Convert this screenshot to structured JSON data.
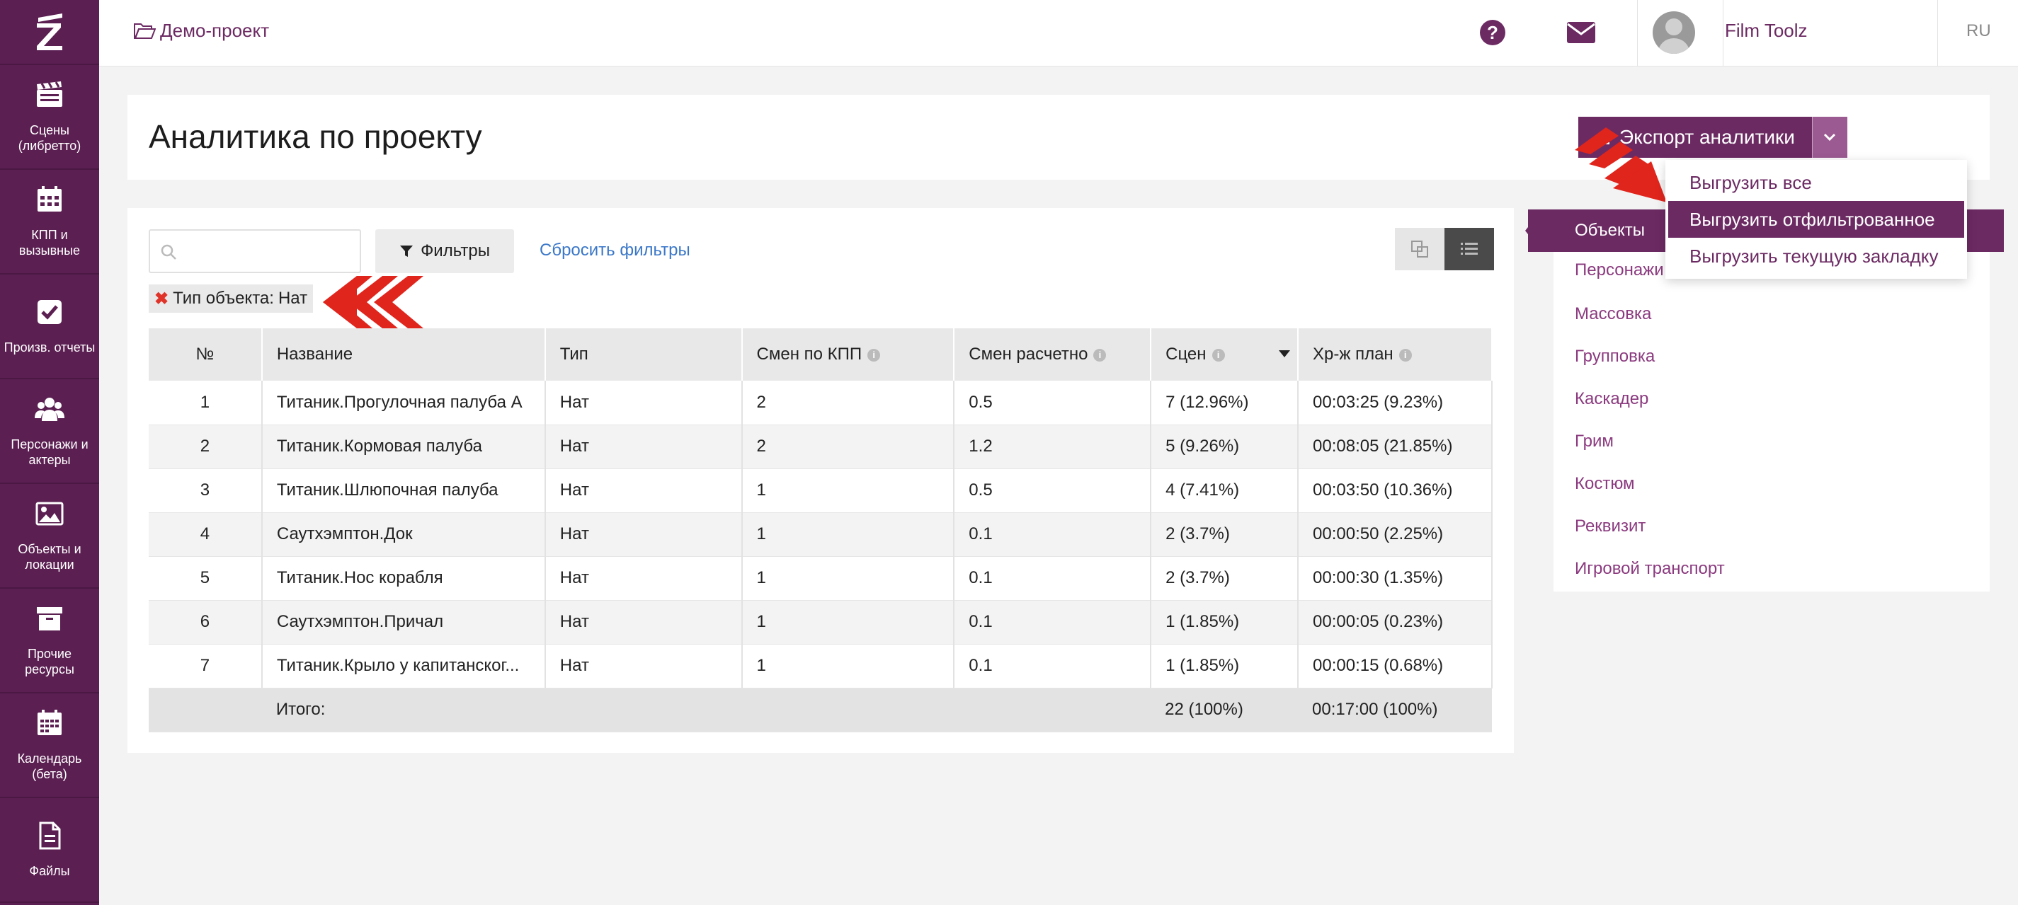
{
  "sidebar": {
    "logo": "Z",
    "items": [
      {
        "label": "Сцены\n(либретто)",
        "icon": "clapperboard-icon"
      },
      {
        "label": "КПП и\nвызывные",
        "icon": "calendar-grid-icon"
      },
      {
        "label": "Произв. отчеты",
        "icon": "checkbox-icon"
      },
      {
        "label": "Персонажи и\nактеры",
        "icon": "people-icon"
      },
      {
        "label": "Объекты и\nлокации",
        "icon": "image-icon"
      },
      {
        "label": "Прочие\nресурсы",
        "icon": "archive-box-icon"
      },
      {
        "label": "Календарь\n(бета)",
        "icon": "calendar-icon"
      },
      {
        "label": "Файлы",
        "icon": "file-icon"
      }
    ]
  },
  "topbar": {
    "project": "Демо-проект",
    "user": "Film Toolz",
    "lang": "RU",
    "help_glyph": "?"
  },
  "page": {
    "title": "Аналитика по проекту"
  },
  "export": {
    "label": "Экспорт аналитики",
    "menu": [
      "Выгрузить все",
      "Выгрузить отфильтрованное",
      "Выгрузить текущую закладку"
    ],
    "active_index": 1
  },
  "filters": {
    "search_placeholder": "",
    "filter_button": "Фильтры",
    "reset": "Сбросить фильтры",
    "chip_label": "Тип объекта:",
    "chip_value": "Нат"
  },
  "table": {
    "headers": [
      "№",
      "Название",
      "Тип",
      "Смен по КПП",
      "Смен расчетно",
      "Сцен",
      "Хр-ж план"
    ],
    "rows": [
      [
        "1",
        "Титаник.Прогулочная палуба A",
        "Нат",
        "2",
        "0.5",
        "7 (12.96%)",
        "00:03:25 (9.23%)"
      ],
      [
        "2",
        "Титаник.Кормовая палуба",
        "Нат",
        "2",
        "1.2",
        "5 (9.26%)",
        "00:08:05 (21.85%)"
      ],
      [
        "3",
        "Титаник.Шлюпочная палуба",
        "Нат",
        "1",
        "0.5",
        "4 (7.41%)",
        "00:03:50 (10.36%)"
      ],
      [
        "4",
        "Саутхэмптон.Док",
        "Нат",
        "1",
        "0.1",
        "2 (3.7%)",
        "00:00:50 (2.25%)"
      ],
      [
        "5",
        "Титаник.Нос корабля",
        "Нат",
        "1",
        "0.1",
        "2 (3.7%)",
        "00:00:30 (1.35%)"
      ],
      [
        "6",
        "Саутхэмптон.Причал",
        "Нат",
        "1",
        "0.1",
        "1 (1.85%)",
        "00:00:05 (0.23%)"
      ],
      [
        "7",
        "Титаник.Крыло у капитанског...",
        "Нат",
        "1",
        "0.1",
        "1 (1.85%)",
        "00:00:15 (0.68%)"
      ]
    ],
    "total": {
      "label": "Итого:",
      "scenes": "22 (100%)",
      "plan": "00:17:00 (100%)"
    }
  },
  "right_panel": {
    "items": [
      "Объекты",
      "Персонажи",
      "Массовка",
      "Групповка",
      "Каскадер",
      "Грим",
      "Костюм",
      "Реквизит",
      "Игровой транспорт"
    ],
    "active_index": 0
  },
  "colors": {
    "brand": "#6c2a63",
    "sidebar": "#5b1f52",
    "link": "#3a77c8",
    "annotation_red": "#e0251c"
  }
}
